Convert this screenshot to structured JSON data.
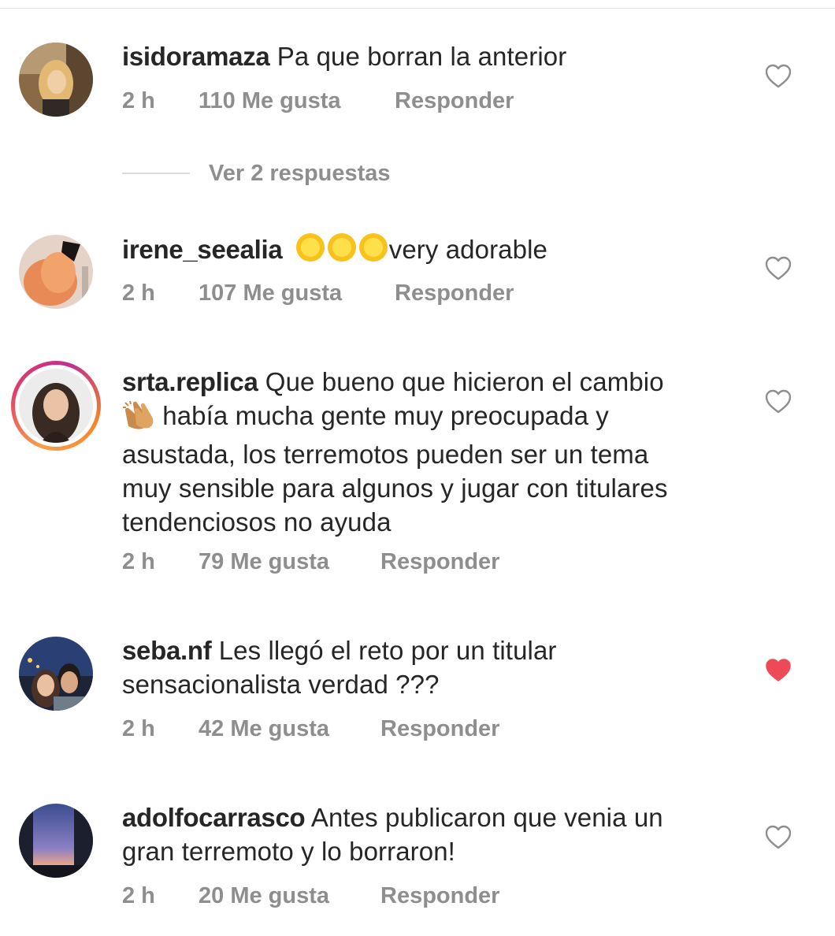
{
  "comments": [
    {
      "username": "isidoramaza",
      "text": "Pa que borran la anterior",
      "time": "2 h",
      "likes": "110 Me gusta",
      "reply": "Responder",
      "liked": false,
      "replies_label": "Ver 2 respuestas"
    },
    {
      "username": "irene_seealia",
      "text": "very adorable",
      "emoji_count": 3,
      "time": "2 h",
      "likes": "107 Me gusta",
      "reply": "Responder",
      "liked": false
    },
    {
      "username": "srta.replica",
      "text_line1": "Que bueno que hicieron el cambio",
      "text_line2": "había mucha gente muy preocupada y",
      "text_line3": "asustada, los terremotos pueden ser un tema",
      "text_line4": "muy sensible para algunos y jugar con titulares",
      "text_line5": "tendenciosos no ayuda",
      "time": "2 h",
      "likes": "79 Me gusta",
      "reply": "Responder",
      "liked": false,
      "has_story": true
    },
    {
      "username": "seba.nf",
      "text_line1": "Les llegó el reto por un titular",
      "text_line2": "sensacionalista verdad ???",
      "time": "2 h",
      "likes": "42 Me gusta",
      "reply": "Responder",
      "liked": true
    },
    {
      "username": "adolfocarrasco",
      "text_line1": "Antes publicaron que venia un",
      "text_line2": "gran terremoto y lo borraron!",
      "time": "2 h",
      "likes": "20 Me gusta",
      "reply": "Responder",
      "liked": false
    }
  ],
  "colors": {
    "text": "#262626",
    "secondary": "#8e8e8e",
    "liked_heart": "#ed4956",
    "divider": "#dbdbdb"
  },
  "icons": {
    "like": "heart-outline-icon",
    "liked": "heart-filled-icon",
    "clap": "clapping-hands-emoji",
    "sun": "sun-face-emoji"
  }
}
